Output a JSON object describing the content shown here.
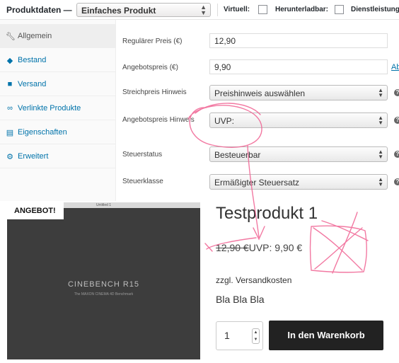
{
  "header": {
    "title": "Produktdaten —",
    "product_type": "Einfaches Produkt",
    "checks": [
      "Virtuell:",
      "Herunterladbar:",
      "Dienstleistung"
    ]
  },
  "tabs": [
    {
      "label": "Allgemein",
      "icon": "wrench-icon",
      "active": true
    },
    {
      "label": "Bestand",
      "icon": "tag-icon"
    },
    {
      "label": "Versand",
      "icon": "truck-icon"
    },
    {
      "label": "Verlinkte Produkte",
      "icon": "link-icon"
    },
    {
      "label": "Eigenschaften",
      "icon": "list-icon"
    },
    {
      "label": "Erweitert",
      "icon": "gear-icon"
    }
  ],
  "fields": {
    "regular_price": {
      "label": "Regulärer Preis (€)",
      "value": "12,90"
    },
    "sale_price": {
      "label": "Angebotspreis (€)",
      "value": "9,90",
      "link": "Ab"
    },
    "strike_hint": {
      "label": "Streichpreis Hinweis",
      "value": "Preishinweis auswählen"
    },
    "sale_hint": {
      "label": "Angebotspreis Hinweis",
      "value": "UVP:"
    },
    "tax_status": {
      "label": "Steuerstatus",
      "value": "Besteuerbar"
    },
    "tax_class": {
      "label": "Steuerklasse",
      "value": "Ermäßigter Steuersatz"
    }
  },
  "storefront": {
    "badge": "ANGEBOT!",
    "image_bar_title": "Untitled 1",
    "image_title": "CINEBENCH R15",
    "image_subtitle": "The MAXON CINEMA 4D Benchmark",
    "product_title": "Testprodukt 1",
    "old_price": "12,90 €",
    "new_price": "UVP: 9,90 €",
    "shipping": "zzgl. Versandkosten",
    "short_description": "Bla Bla Bla",
    "quantity": "1",
    "cart_button": "In den Warenkorb"
  },
  "colors": {
    "link": "#0073aa",
    "cart_button": "#222222",
    "annotation": "#f06292"
  }
}
